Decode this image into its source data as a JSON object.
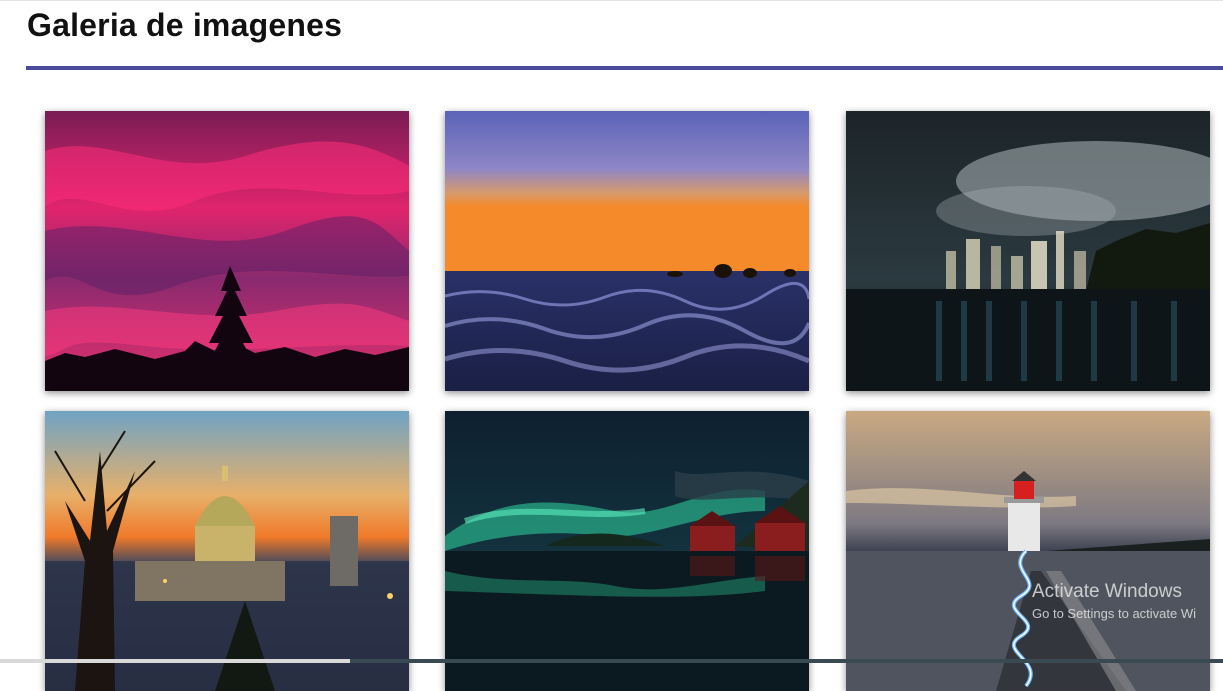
{
  "page": {
    "title": "Galeria de imagenes"
  },
  "gallery": {
    "images": [
      {
        "subject": "pink sunset sky with pine tree silhouette"
      },
      {
        "subject": "ocean waves at sunset with swimmers"
      },
      {
        "subject": "city skyline at night with reflections"
      },
      {
        "subject": "domed cathedral at dusk"
      },
      {
        "subject": "aurora over lake with red houses"
      },
      {
        "subject": "lighthouse at night with light trail"
      }
    ]
  },
  "watermark": {
    "title": "Activate Windows",
    "subtitle": "Go to Settings to activate Wi"
  },
  "colors": {
    "accent": "#4c4c9c"
  }
}
